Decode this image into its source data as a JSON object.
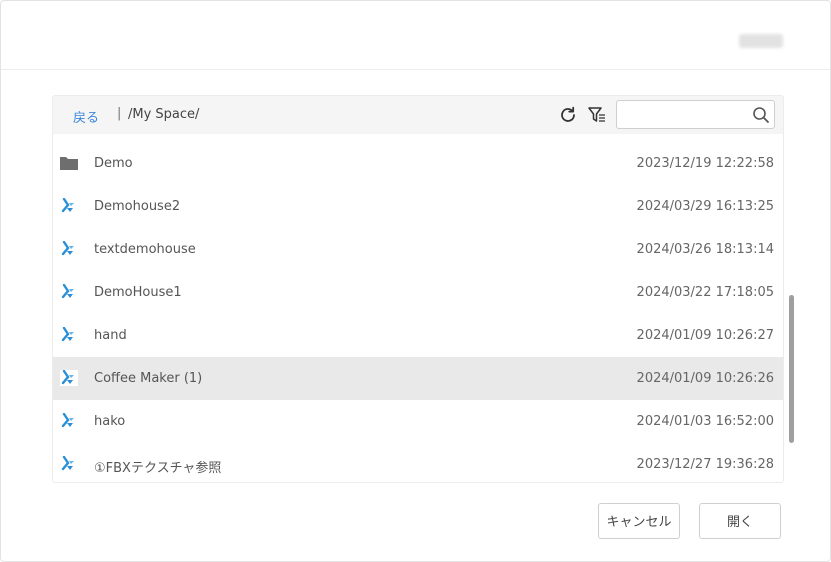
{
  "toolbar": {
    "back_label": "戻る",
    "separator": "|",
    "path": "/My Space/",
    "refresh_icon": "refresh-icon",
    "filter_icon": "filter-icon",
    "search": {
      "value": "",
      "placeholder": ""
    }
  },
  "files": [
    {
      "icon": "folder-icon",
      "name": "Demo",
      "date": "2023/12/19 12:22:58",
      "selected": false
    },
    {
      "icon": "model-file-icon",
      "name": "Demohouse2",
      "date": "2024/03/29 16:13:25",
      "selected": false
    },
    {
      "icon": "model-file-icon",
      "name": "textdemohouse",
      "date": "2024/03/26 18:13:14",
      "selected": false
    },
    {
      "icon": "model-file-icon",
      "name": "DemoHouse1",
      "date": "2024/03/22 17:18:05",
      "selected": false
    },
    {
      "icon": "model-file-icon",
      "name": "hand",
      "date": "2024/01/09 10:26:27",
      "selected": false
    },
    {
      "icon": "model-file-icon",
      "name": "Coffee Maker (1)",
      "date": "2024/01/09 10:26:26",
      "selected": true
    },
    {
      "icon": "model-file-icon",
      "name": "hako",
      "date": "2024/01/03 16:52:00",
      "selected": false
    },
    {
      "icon": "model-file-icon",
      "name": "①FBXテクスチャ参照",
      "date": "2023/12/27 19:36:28",
      "selected": false
    }
  ],
  "buttons": {
    "cancel_label": "キャンセル",
    "open_label": "開く"
  },
  "colors": {
    "link": "#3b86d8",
    "selected_row": "#e9e9e9",
    "file_icon": "#2a8fd6"
  }
}
